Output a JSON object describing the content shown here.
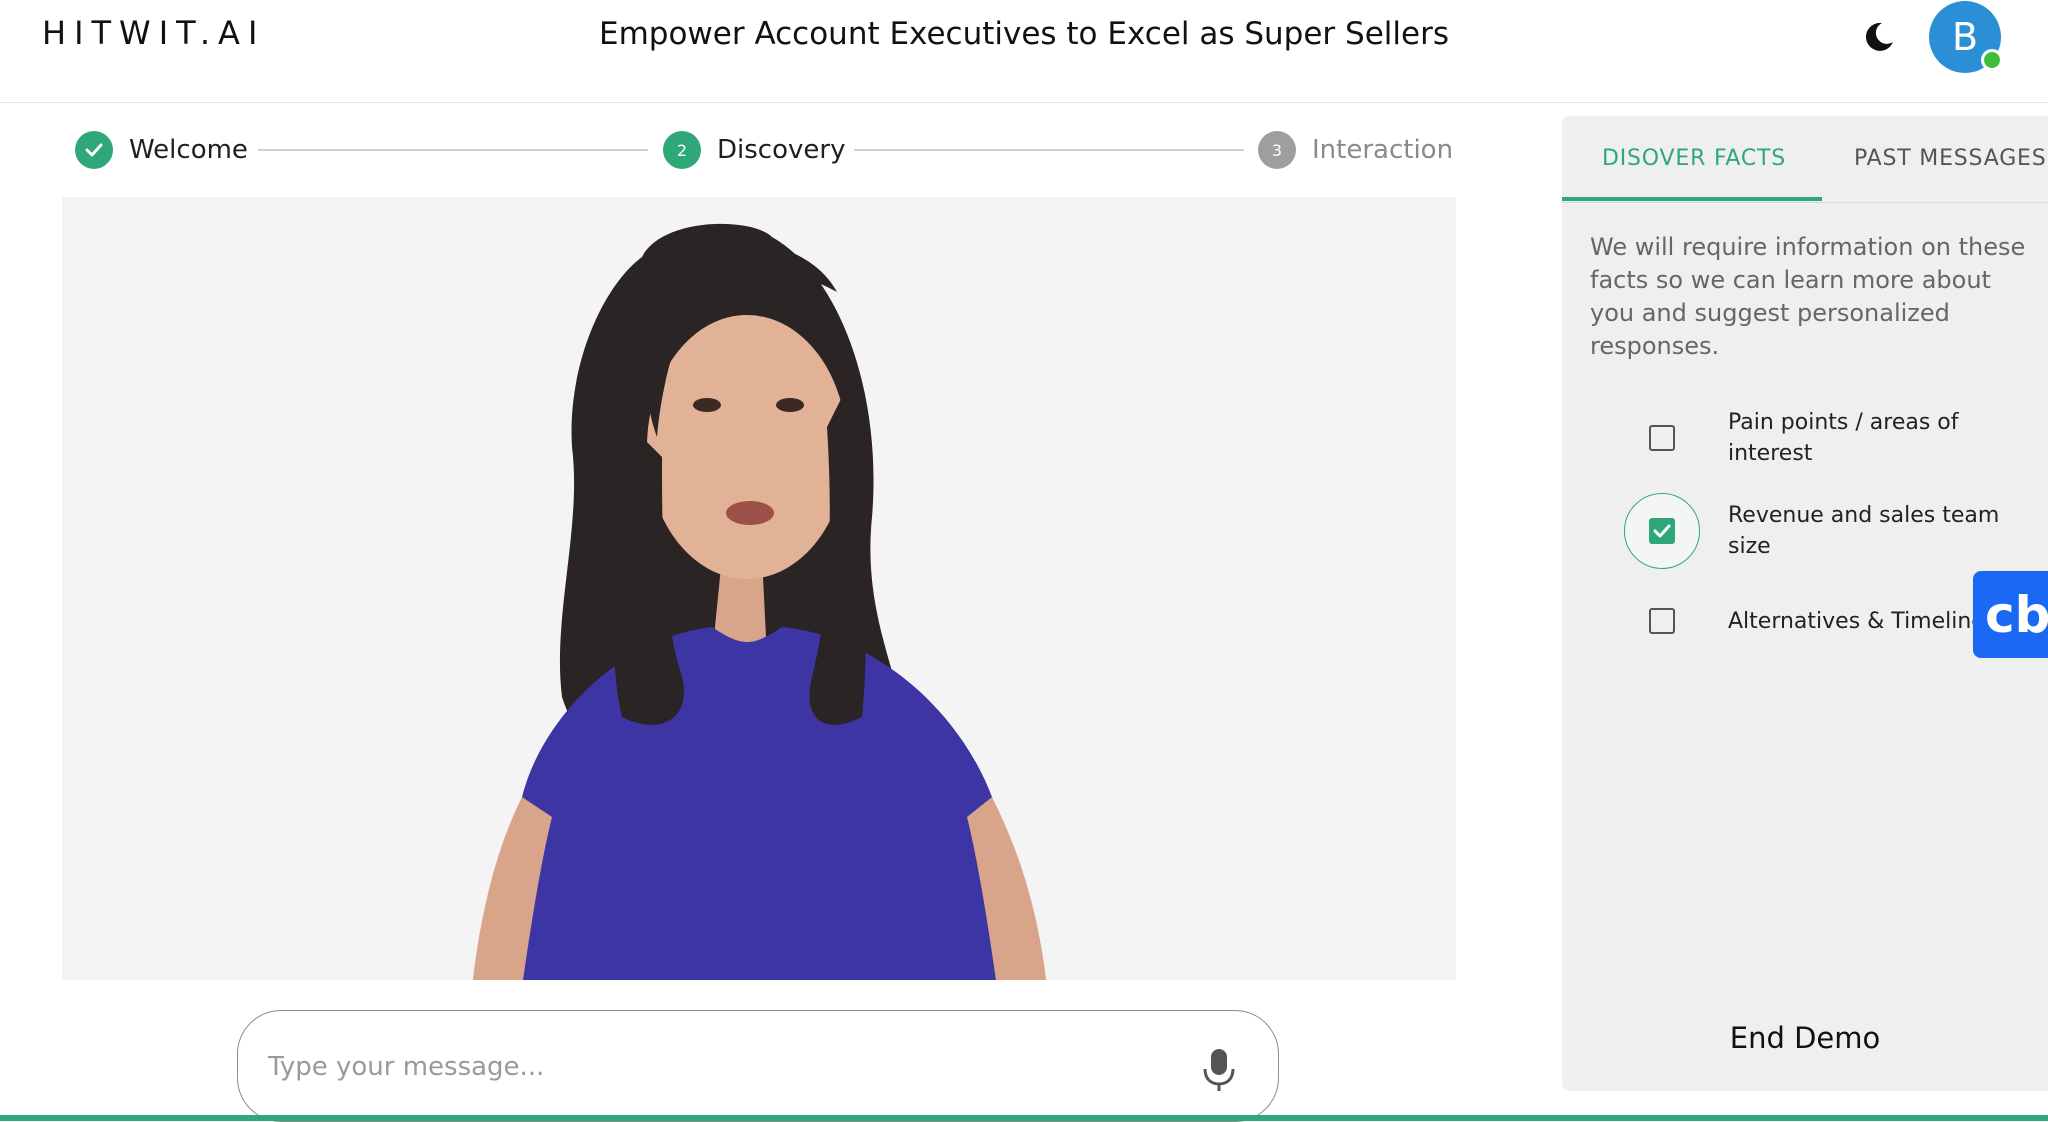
{
  "header": {
    "logo": "HITWIT.AI",
    "title": "Empower Account Executives to Excel as Super Sellers",
    "avatar_initial": "B",
    "icons": [
      "moon-icon"
    ]
  },
  "stepper": {
    "steps": [
      {
        "number": "1",
        "label": "Welcome",
        "state": "completed"
      },
      {
        "number": "2",
        "label": "Discovery",
        "state": "active"
      },
      {
        "number": "3",
        "label": "Interaction",
        "state": "pending"
      }
    ]
  },
  "message": {
    "placeholder": "Type your message...",
    "value": ""
  },
  "panel": {
    "tabs": [
      {
        "label": "DISOVER FACTS",
        "active": true
      },
      {
        "label": "PAST MESSAGES",
        "active": false
      }
    ],
    "intro": "We will require information on these facts so we can learn more about you and suggest personalized responses.",
    "facts": [
      {
        "label": "Pain points / areas of interest",
        "checked": false
      },
      {
        "label": "Revenue and sales team size",
        "checked": true
      },
      {
        "label": "Alternatives & Timeline",
        "checked": false
      }
    ],
    "end_demo": "End Demo"
  },
  "badge": {
    "text": "cb"
  },
  "colors": {
    "accent": "#2ea879",
    "avatar": "#2b8fd6",
    "presence": "#3bbf3b",
    "badge": "#1b68f5",
    "shirt": "#3d35a3"
  }
}
